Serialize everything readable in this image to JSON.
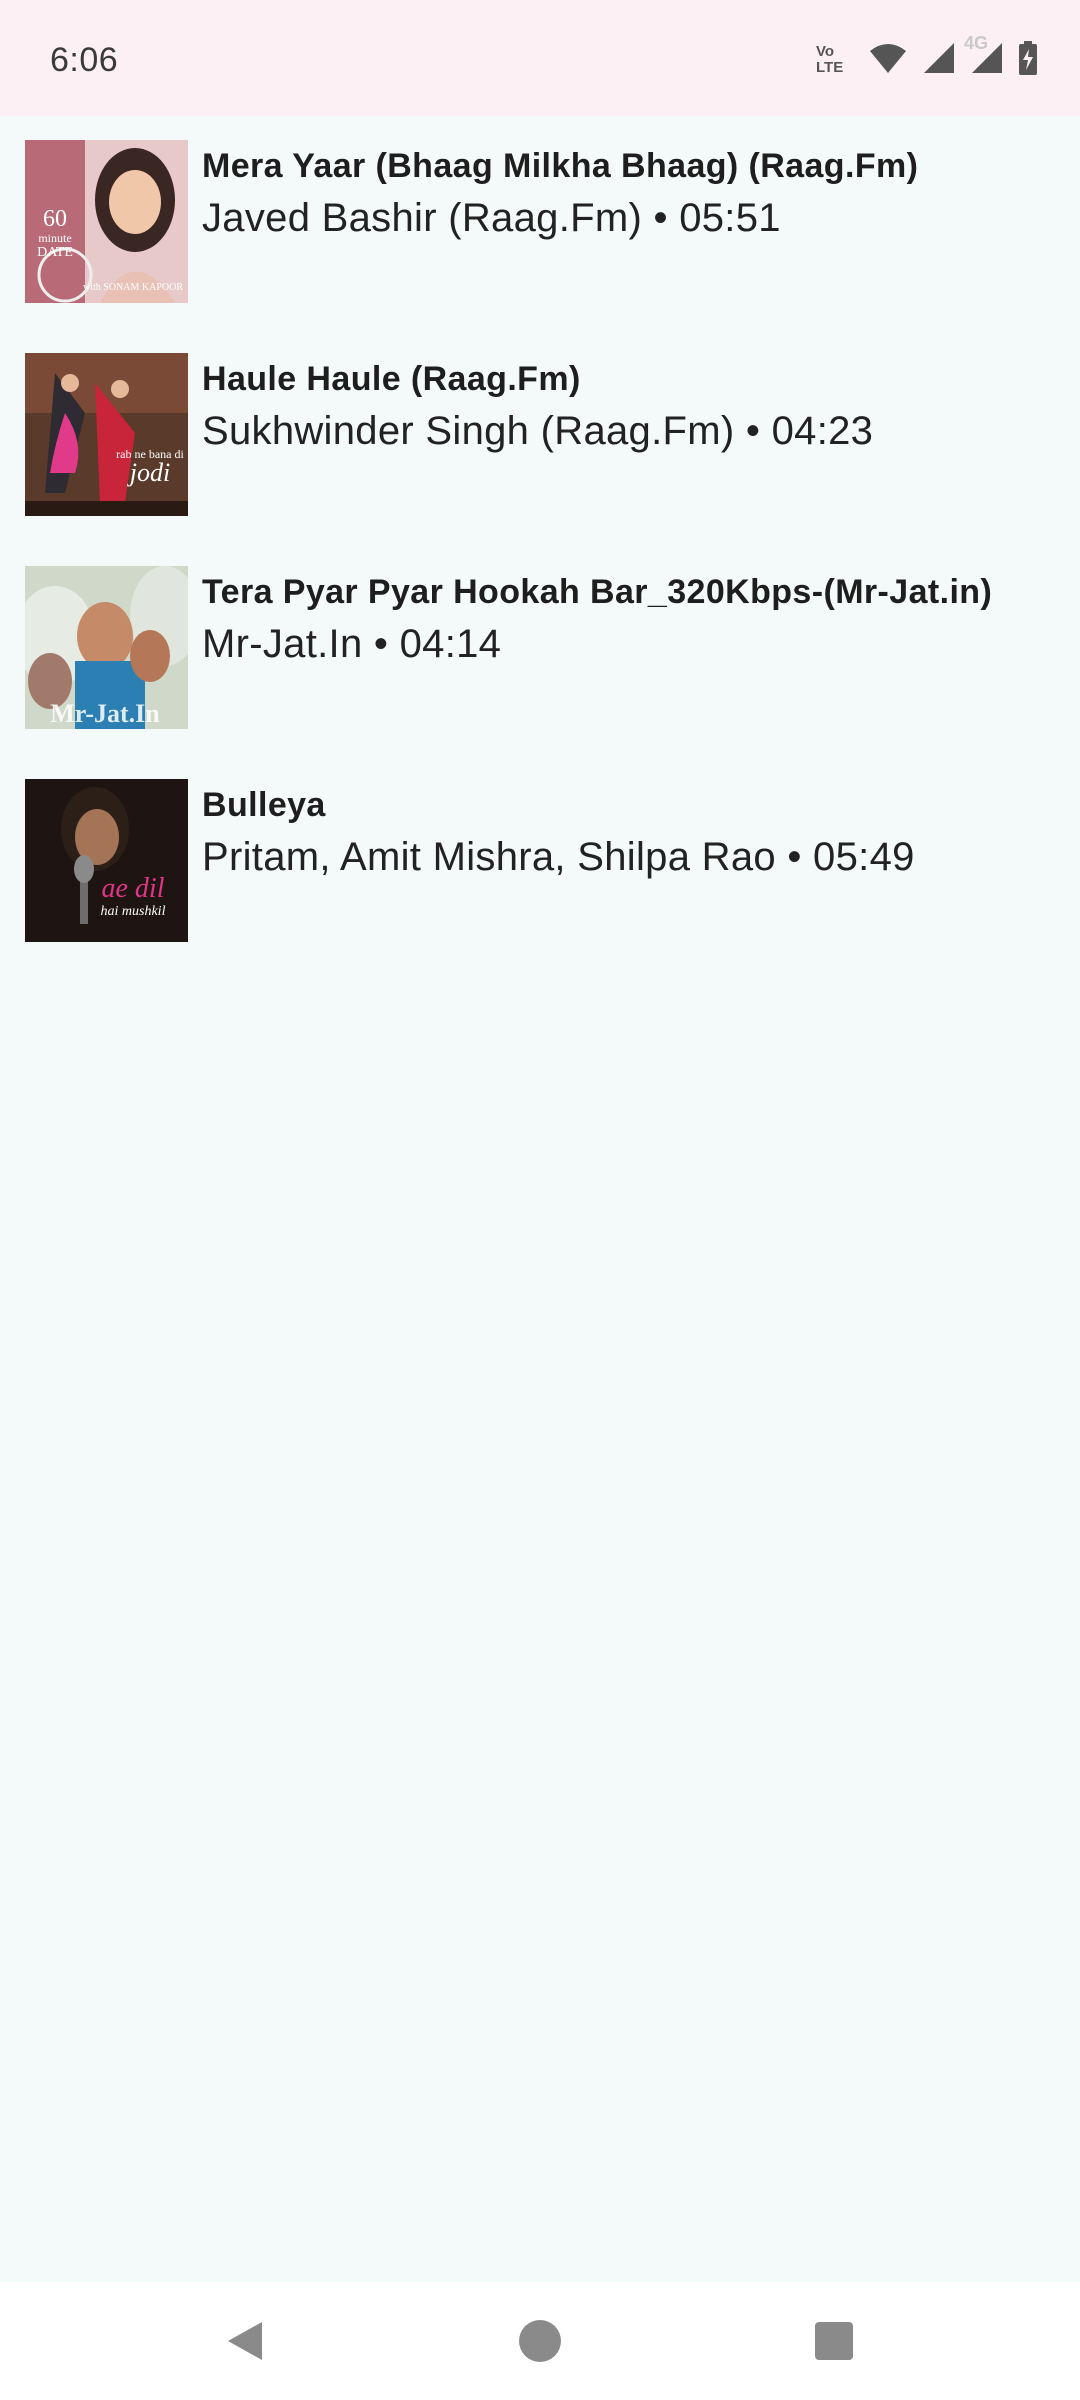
{
  "status_bar": {
    "time": "6:06",
    "volte_top": "Vo",
    "volte_bottom": "LTE",
    "network_type": "4G",
    "icons": [
      "volte-icon",
      "wifi-icon",
      "signal-icon",
      "signal-4g-icon",
      "battery-charging-icon"
    ]
  },
  "songs": [
    {
      "title": "Mera Yaar (Bhaag Milkha Bhaag) (Raag.Fm)",
      "meta": "Javed Bashir (Raag.Fm) • 05:51",
      "art_label_top": "60",
      "art_label_mid": "minute",
      "art_label_bottom": "DATE",
      "art_caption": "with SONAM KAPOOR"
    },
    {
      "title": "Haule Haule (Raag.Fm)",
      "meta": "Sukhwinder Singh (Raag.Fm) • 04:23",
      "art_label_top": "rab ne bana di",
      "art_label_mid": "jodi"
    },
    {
      "title": "Tera Pyar Pyar Hookah Bar_320Kbps-(Mr-Jat.in)",
      "meta": "Mr-Jat.In • 04:14",
      "art_caption": "Mr-Jat.In"
    },
    {
      "title": "Bulleya",
      "meta": "Pritam, Amit Mishra, Shilpa Rao • 05:49",
      "art_label_top": "ae dil",
      "art_label_mid": "hai mushkil"
    }
  ],
  "nav_bar": {
    "icons": [
      "back-icon",
      "home-icon",
      "recents-icon"
    ]
  },
  "colors": {
    "status_bar_bg": "#fcf0f4",
    "list_bg": "#f4f9f9",
    "nav_bar_bg": "#ffffff",
    "nav_icon": "#8a8a8a"
  }
}
